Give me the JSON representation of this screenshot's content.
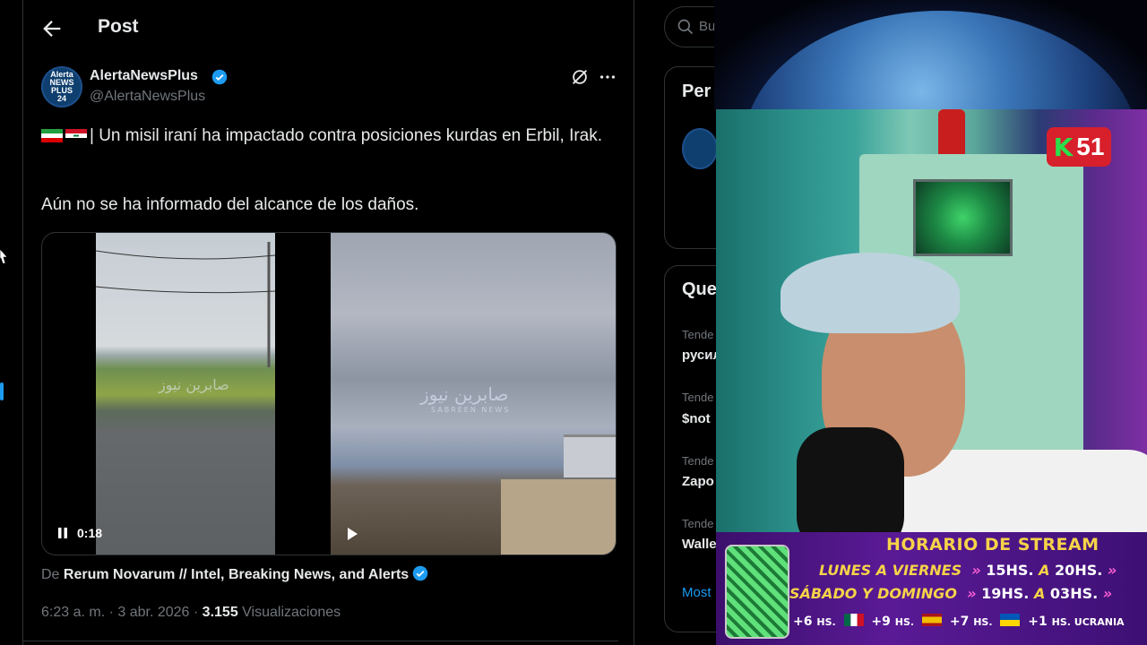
{
  "header": {
    "title": "Post"
  },
  "author": {
    "name": "AlertaNewsPlus",
    "handle": "@AlertaNewsPlus",
    "avatar_text": "Alerta NEWS PLUS 24"
  },
  "tweet": {
    "line1": "| Un misil iraní ha impactado contra posiciones kurdas en Erbil, Irak.",
    "line2": "Aún no se ha informado del alcance de los daños."
  },
  "media": {
    "watermark": "صابرين نيوز",
    "watermark_sub": "SABREEN NEWS",
    "elapsed": "0:18"
  },
  "attribution": {
    "prefix": "De",
    "source": "Rerum Novarum // Intel, Breaking News, and Alerts"
  },
  "meta": {
    "time_date": "6:23 a. m. · 3 abr. 2026 ·",
    "views": "3.155",
    "views_label": "Visualizaciones"
  },
  "sidebar": {
    "search_placeholder": "Bu",
    "card1_title": "Per",
    "card2_title": "Que",
    "trends": [
      {
        "category": "Tende",
        "name": "русил"
      },
      {
        "category": "Tende",
        "name": "$not"
      },
      {
        "category": "Tende",
        "name": "Zapo"
      },
      {
        "category": "Tende",
        "name": "Walle"
      }
    ],
    "show_more": "Most"
  },
  "overlay": {
    "badge": "51",
    "badge_letter": "K",
    "schedule_title": "HORARIO DE STREAM",
    "row1_days": "LUNES A VIERNES",
    "row1_start": "15HS.",
    "row1_sep": "A",
    "row1_end": "20HS.",
    "row2_days": "SÁBADO Y DOMINGO",
    "row2_start": "19HS.",
    "row2_sep": "A",
    "row2_end": "03HS.",
    "tz1": "+6",
    "tz1_unit": "HS.",
    "tz2": "+9",
    "tz2_unit": "HS.",
    "tz3": "+7",
    "tz3_unit": "HS.",
    "tz4": "+1",
    "tz4_unit": "HS. UCRANIA"
  },
  "colors": {
    "accent": "#1d9bf0",
    "muted": "#71767b",
    "schedule_yellow": "#f6d348"
  }
}
